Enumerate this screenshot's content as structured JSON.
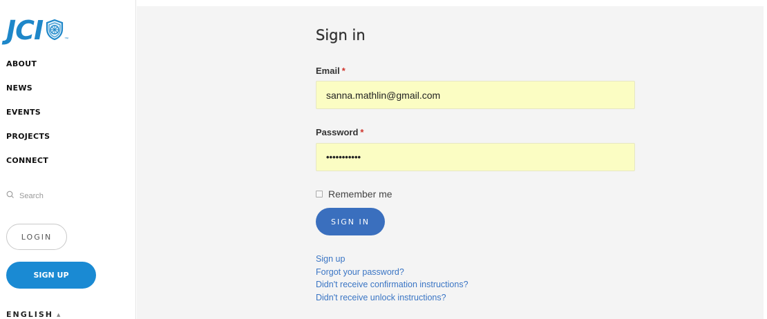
{
  "sidebar": {
    "logo": {
      "text": "JCI",
      "tm": "™",
      "color": "#1e87c9"
    },
    "nav": [
      "ABOUT",
      "NEWS",
      "EVENTS",
      "PROJECTS",
      "CONNECT"
    ],
    "search_placeholder": "Search",
    "login_label": "LOGIN",
    "signup_label": "SIGN UP",
    "language": "ENGLISH",
    "accent_color": "#1a8ad3"
  },
  "form": {
    "title": "Sign in",
    "email_label": "Email",
    "email_value": "sanna.mathlin@gmail.com",
    "password_label": "Password",
    "password_mask": "•••••••••••",
    "required_mark": "*",
    "remember_label": "Remember me",
    "remember_checked": false,
    "submit_label": "SIGN IN",
    "autofill_color": "#fbfdc3",
    "links": [
      "Sign up",
      "Forgot your password?",
      "Didn't receive confirmation instructions?",
      "Didn't receive unlock instructions?"
    ]
  }
}
